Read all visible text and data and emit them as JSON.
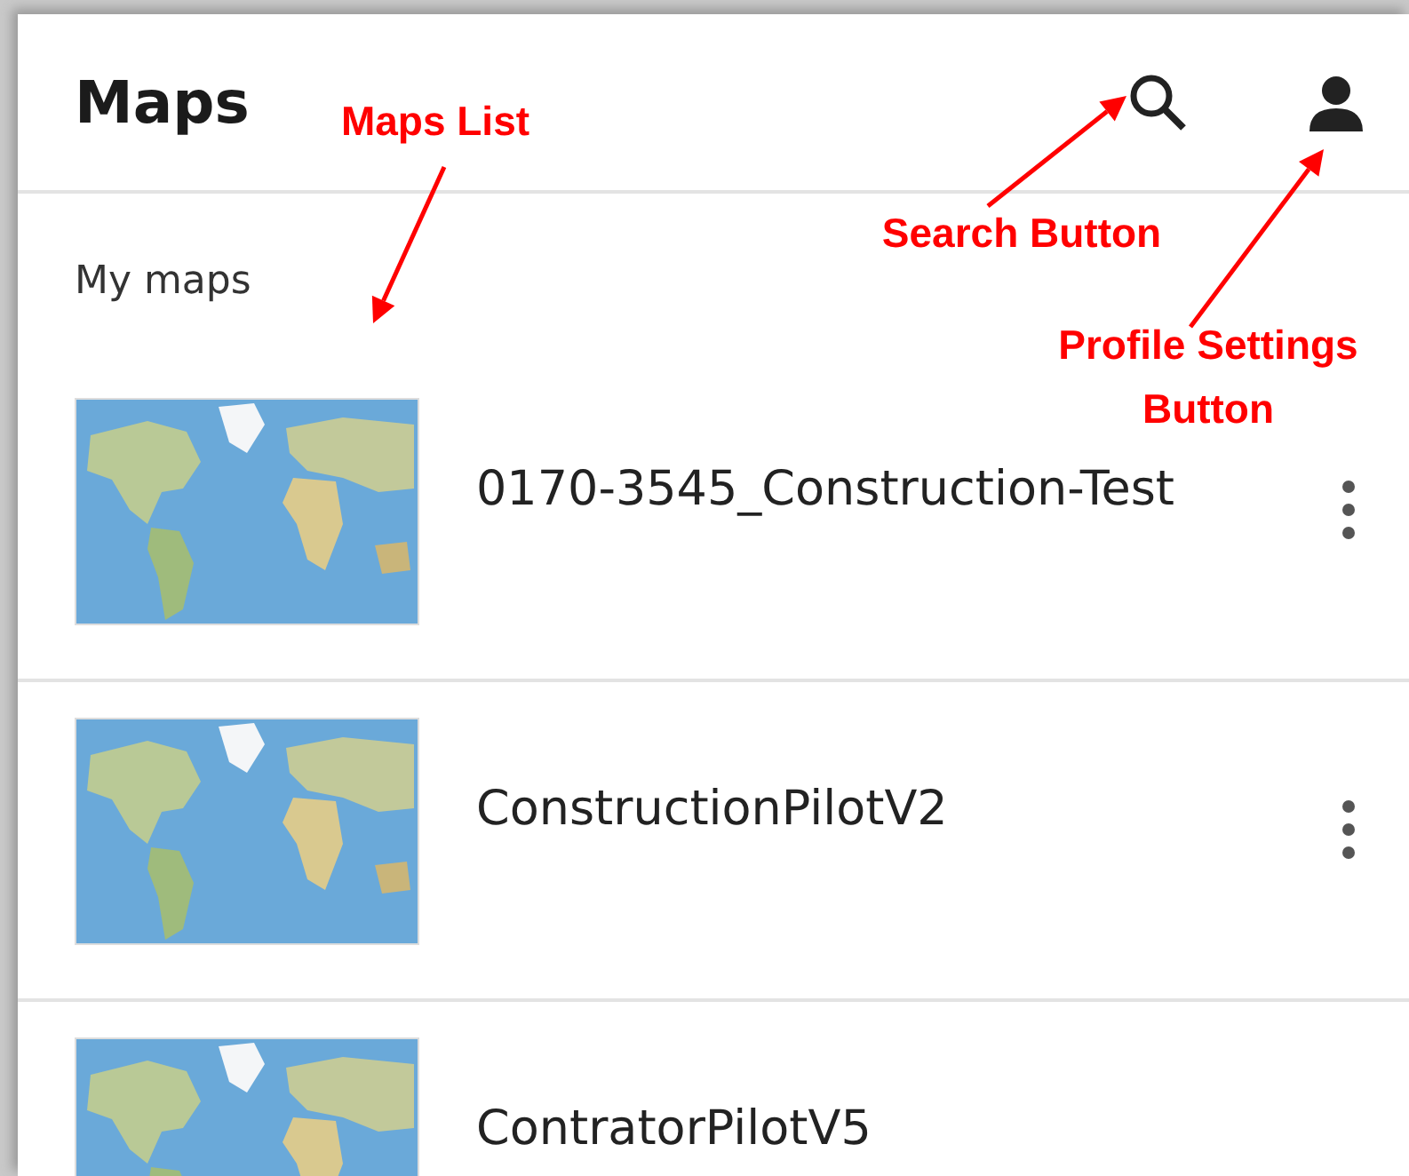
{
  "app_bar": {
    "title": "Maps"
  },
  "section": {
    "title": "My maps"
  },
  "maps": [
    {
      "name": "0170-3545_Construction-Test"
    },
    {
      "name": "ConstructionPilotV2"
    },
    {
      "name": "ContratorPilotV5"
    }
  ],
  "annotations": [
    {
      "kind": "list",
      "text": "Maps List"
    },
    {
      "kind": "search",
      "text": "Search Button"
    },
    {
      "kind": "profile",
      "text": "Profile Settings Button"
    }
  ]
}
